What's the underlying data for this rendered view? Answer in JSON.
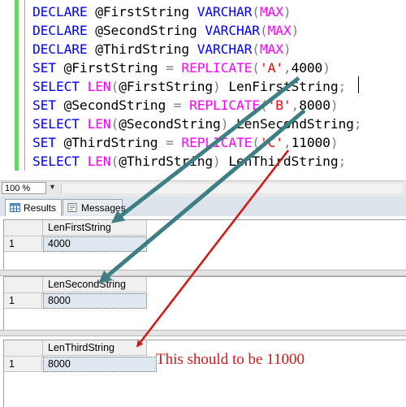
{
  "editor": {
    "lines": [
      [
        {
          "t": "DECLARE",
          "c": "kw"
        },
        {
          "t": " @FirstString ",
          "c": "blk"
        },
        {
          "t": "VARCHAR",
          "c": "kw"
        },
        {
          "t": "(",
          "c": "gry"
        },
        {
          "t": "MAX",
          "c": "fn"
        },
        {
          "t": ")",
          "c": "gry"
        }
      ],
      [
        {
          "t": "DECLARE",
          "c": "kw"
        },
        {
          "t": " @SecondString ",
          "c": "blk"
        },
        {
          "t": "VARCHAR",
          "c": "kw"
        },
        {
          "t": "(",
          "c": "gry"
        },
        {
          "t": "MAX",
          "c": "fn"
        },
        {
          "t": ")",
          "c": "gry"
        }
      ],
      [
        {
          "t": "DECLARE",
          "c": "kw"
        },
        {
          "t": " @ThirdString ",
          "c": "blk"
        },
        {
          "t": "VARCHAR",
          "c": "kw"
        },
        {
          "t": "(",
          "c": "gry"
        },
        {
          "t": "MAX",
          "c": "fn"
        },
        {
          "t": ")",
          "c": "gry"
        }
      ],
      [
        {
          "t": "SET",
          "c": "kw"
        },
        {
          "t": " @FirstString ",
          "c": "blk"
        },
        {
          "t": "=",
          "c": "gry"
        },
        {
          "t": " ",
          "c": "blk"
        },
        {
          "t": "REPLICATE",
          "c": "fn"
        },
        {
          "t": "(",
          "c": "gry"
        },
        {
          "t": "'A'",
          "c": "str"
        },
        {
          "t": ",",
          "c": "gry"
        },
        {
          "t": "4000",
          "c": "blk"
        },
        {
          "t": ")",
          "c": "gry"
        }
      ],
      [
        {
          "t": "SELECT",
          "c": "kw"
        },
        {
          "t": " ",
          "c": "blk"
        },
        {
          "t": "LEN",
          "c": "fn"
        },
        {
          "t": "(",
          "c": "gry"
        },
        {
          "t": "@FirstString",
          "c": "blk"
        },
        {
          "t": ")",
          "c": "gry"
        },
        {
          "t": " LenFirstString",
          "c": "blk"
        },
        {
          "t": ";",
          "c": "gry"
        }
      ],
      [
        {
          "t": "SET",
          "c": "kw"
        },
        {
          "t": " @SecondString ",
          "c": "blk"
        },
        {
          "t": "=",
          "c": "gry"
        },
        {
          "t": " ",
          "c": "blk"
        },
        {
          "t": "REPLICATE",
          "c": "fn"
        },
        {
          "t": "(",
          "c": "gry"
        },
        {
          "t": "'B'",
          "c": "str"
        },
        {
          "t": ",",
          "c": "gry"
        },
        {
          "t": "8000",
          "c": "blk"
        },
        {
          "t": ")",
          "c": "gry"
        }
      ],
      [
        {
          "t": "SELECT",
          "c": "kw"
        },
        {
          "t": " ",
          "c": "blk"
        },
        {
          "t": "LEN",
          "c": "fn"
        },
        {
          "t": "(",
          "c": "gry"
        },
        {
          "t": "@SecondString",
          "c": "blk"
        },
        {
          "t": ")",
          "c": "gry"
        },
        {
          "t": " LenSecondString",
          "c": "blk"
        },
        {
          "t": ";",
          "c": "gry"
        }
      ],
      [
        {
          "t": "SET",
          "c": "kw"
        },
        {
          "t": " @ThirdString ",
          "c": "blk"
        },
        {
          "t": "=",
          "c": "gry"
        },
        {
          "t": " ",
          "c": "blk"
        },
        {
          "t": "REPLICATE",
          "c": "fn"
        },
        {
          "t": "(",
          "c": "gry"
        },
        {
          "t": "'C'",
          "c": "str"
        },
        {
          "t": ",",
          "c": "gry"
        },
        {
          "t": "11000",
          "c": "blk"
        },
        {
          "t": ")",
          "c": "gry"
        }
      ],
      [
        {
          "t": "SELECT",
          "c": "kw"
        },
        {
          "t": " ",
          "c": "blk"
        },
        {
          "t": "LEN",
          "c": "fn"
        },
        {
          "t": "(",
          "c": "gry"
        },
        {
          "t": "@ThirdString",
          "c": "blk"
        },
        {
          "t": ")",
          "c": "gry"
        },
        {
          "t": " LenThirdString",
          "c": "blk"
        },
        {
          "t": ";",
          "c": "gry"
        }
      ]
    ]
  },
  "zoom": {
    "value": "100 %"
  },
  "tabs": {
    "results": "Results",
    "messages": "Messages"
  },
  "grids": [
    {
      "column": "LenFirstString",
      "row_number": "1",
      "value": "4000"
    },
    {
      "column": "LenSecondString",
      "row_number": "1",
      "value": "8000"
    },
    {
      "column": "LenThirdString",
      "row_number": "1",
      "value": "8000"
    }
  ],
  "annotation": {
    "text": "This should to be 11000",
    "color": "#d11a1a"
  },
  "colors": {
    "keyword": "#0000ff",
    "function": "#ff00ff",
    "string": "#ff0000",
    "arrow_teal": "#3e7f86",
    "arrow_red": "#d11a1a"
  }
}
